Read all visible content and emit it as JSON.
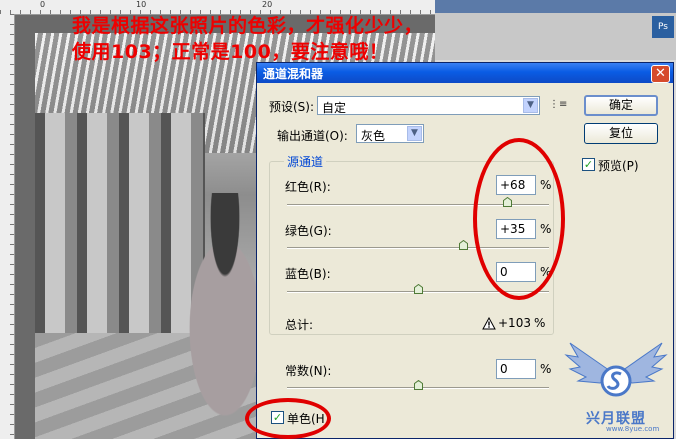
{
  "ruler": {
    "n0": "0",
    "n1": "10",
    "n2": "20"
  },
  "annotation": {
    "line1": "我是根据这张照片的色彩，才强化少少，",
    "line2": "使用103；正常是100，要注意哦！"
  },
  "dialog": {
    "title": "通道混和器",
    "close_glyph": "✕",
    "preset_label": "预设(S):",
    "preset_value": "自定",
    "output_label": "输出通道(O):",
    "output_value": "灰色",
    "group_title": "源通道",
    "red": {
      "label": "红色(R):",
      "value": "+68",
      "unit": "%",
      "level": 0.84
    },
    "green": {
      "label": "绿色(G):",
      "value": "+35",
      "unit": "%",
      "level": 0.675
    },
    "blue": {
      "label": "蓝色(B):",
      "value": "0",
      "unit": "%",
      "level": 0.5
    },
    "total_label": "总计:",
    "total_value": "+103",
    "total_unit": "%",
    "constant": {
      "label": "常数(N):",
      "value": "0",
      "unit": "%",
      "level": 0.5
    },
    "monochrome_label": "单色(H)",
    "monochrome_checked": true,
    "ok_label": "确定",
    "reset_label": "复位",
    "preview_label": "预览(P)",
    "preview_checked": true
  },
  "watermark": {
    "text": "兴月联盟",
    "sub": "www.8yue.com"
  },
  "colors": {
    "annotation": "#ee0000",
    "titlebar": "#0a5ce4",
    "group_title": "#0046d5"
  }
}
